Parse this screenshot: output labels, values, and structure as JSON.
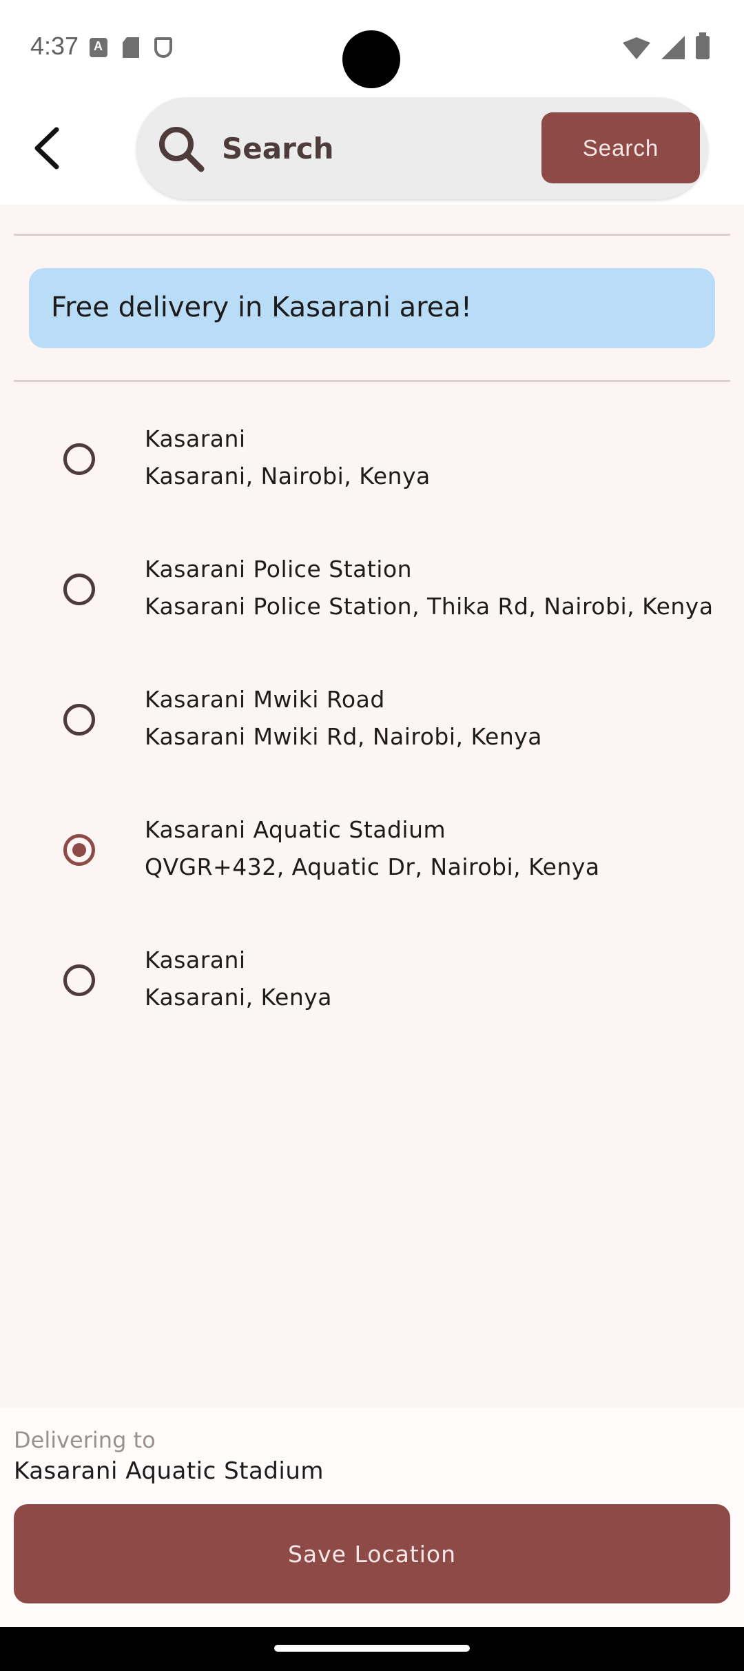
{
  "status_bar": {
    "time": "4:37"
  },
  "header": {
    "search_placeholder": "Search",
    "search_button_label": "Search"
  },
  "banner": {
    "text": "Free delivery in Kasarani area!"
  },
  "options": [
    {
      "title": "Kasarani",
      "subtitle": "Kasarani, Nairobi, Kenya",
      "selected": false
    },
    {
      "title": "Kasarani Police Station",
      "subtitle": "Kasarani Police Station, Thika Rd, Nairobi, Kenya",
      "selected": false
    },
    {
      "title": "Kasarani Mwiki Road",
      "subtitle": "Kasarani Mwiki Rd, Nairobi, Kenya",
      "selected": false
    },
    {
      "title": "Kasarani Aquatic Stadium",
      "subtitle": "QVGR+432, Aquatic Dr, Nairobi, Kenya",
      "selected": true
    },
    {
      "title": "Kasarani",
      "subtitle": "Kasarani, Kenya",
      "selected": false
    }
  ],
  "footer": {
    "delivering_label": "Delivering to",
    "delivering_value": "Kasarani Aquatic Stadium",
    "save_label": "Save Location"
  },
  "colors": {
    "accent": "#8e4a46",
    "banner": "#b9dcf7",
    "background": "#fdf5f4"
  }
}
